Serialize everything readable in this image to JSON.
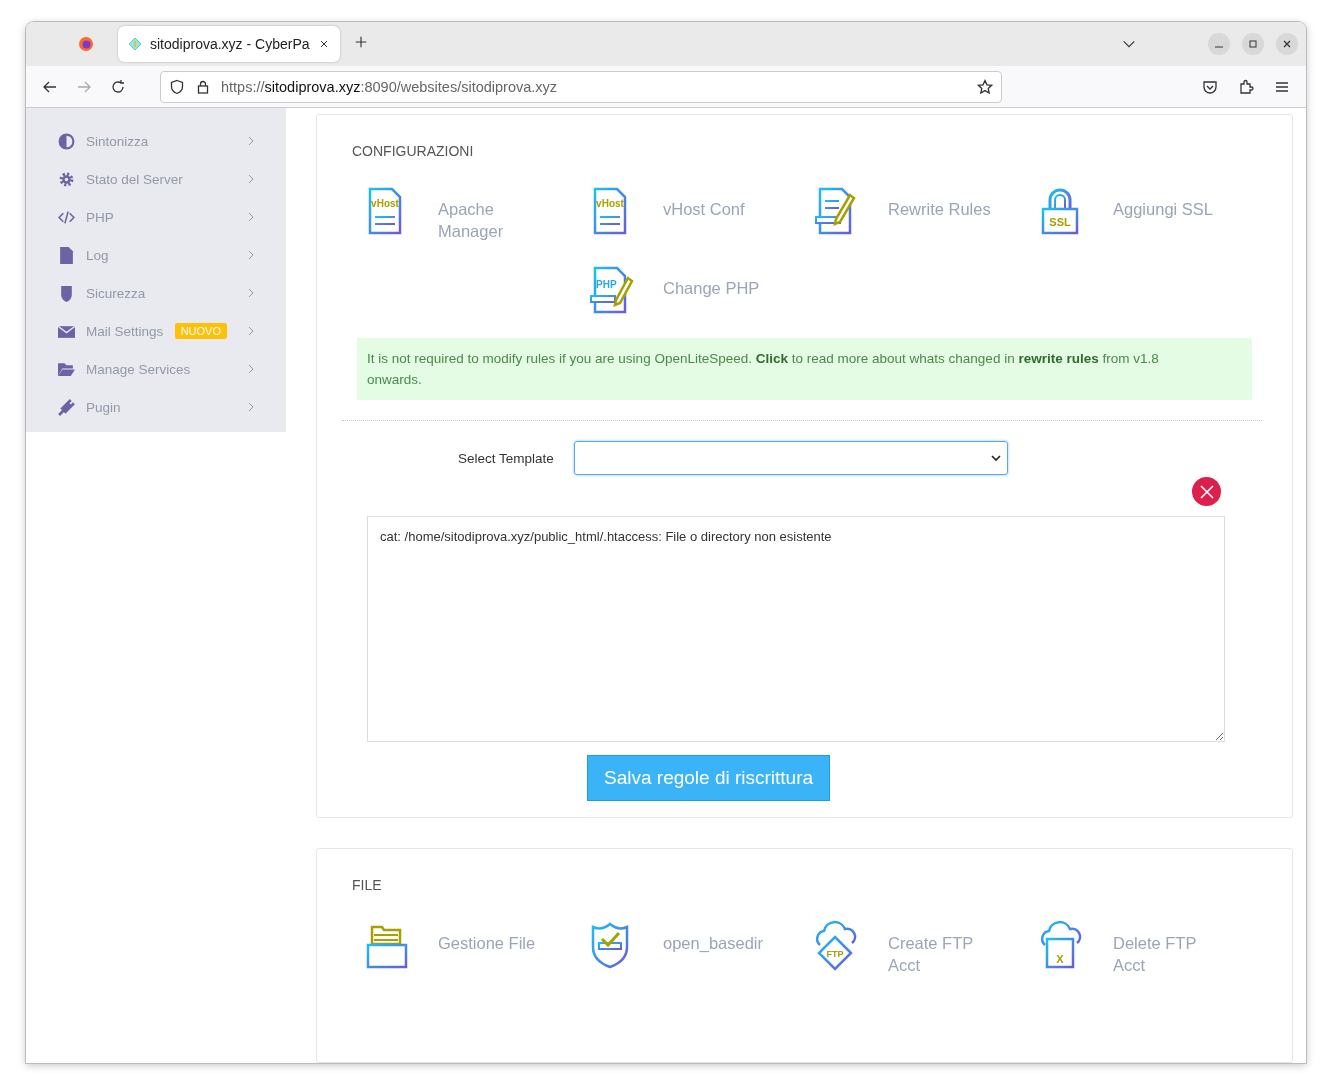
{
  "browser": {
    "tab_title": "sitodiprova.xyz - CyberPa",
    "url_scheme": "https://",
    "url_host": "sitodiprova.xyz",
    "url_rest": ":8090/websites/sitodiprova.xyz"
  },
  "sidebar": {
    "items": [
      {
        "label": "Sintonizza",
        "kind": "contrast"
      },
      {
        "label": "Stato del Server",
        "kind": "gear"
      },
      {
        "label": "PHP",
        "kind": "code"
      },
      {
        "label": "Log",
        "kind": "file"
      },
      {
        "label": "Sicurezza",
        "kind": "shield"
      },
      {
        "label": "Mail Settings",
        "kind": "mail",
        "badge": "NUOVO"
      },
      {
        "label": "Manage Services",
        "kind": "folder"
      },
      {
        "label": "Pugin",
        "kind": "plug"
      }
    ]
  },
  "config": {
    "title": "CONFIGURAZIONI",
    "rows": [
      [
        {
          "label": "Apache Manager",
          "kind": "vhost",
          "icon_text": "vHost"
        },
        {
          "label": "vHost Conf",
          "kind": "vhost",
          "icon_text": "vHost"
        },
        {
          "label": "Rewrite Rules",
          "kind": "rewrite"
        },
        {
          "label": "Aggiungi SSL",
          "kind": "ssl",
          "icon_text": "SSL"
        }
      ],
      [
        "",
        {
          "label": "Change PHP",
          "kind": "php",
          "icon_text": "PHP"
        }
      ]
    ],
    "notice": "It is not required to modify rules if you are using OpenLiteSpeed. **Click** to read more about whats changed in **rewrite rules** from v1.8 onwards.",
    "template_label": "Select Template",
    "rules_text": "cat: /home/sitodiprova.xyz/public_html/.htaccess: File o directory non esistente",
    "save_button": "Salva regole di riscrittura"
  },
  "files": {
    "title": "FILE",
    "rows": [
      [
        {
          "label": "Gestione File",
          "kind": "files"
        },
        {
          "label": "open_basedir",
          "kind": "basedir"
        },
        {
          "label": "Create FTP Acct",
          "kind": "ftp-create",
          "icon_text": "FTP"
        },
        {
          "label": "Delete FTP Acct",
          "kind": "ftp-delete",
          "icon_text": "X"
        }
      ]
    ]
  }
}
